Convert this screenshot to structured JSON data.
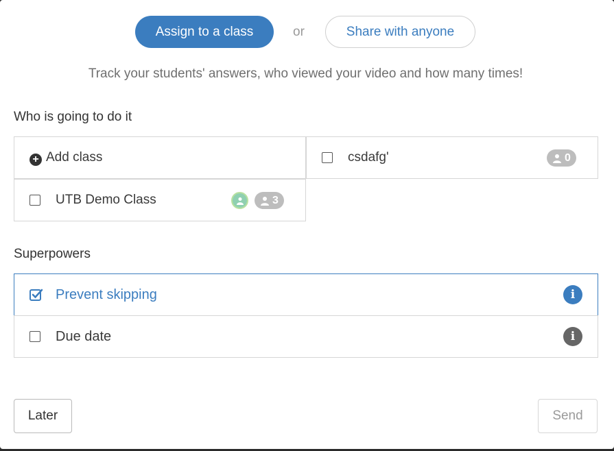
{
  "mode_switch": {
    "assign_label": "Assign to a class",
    "or_label": "or",
    "share_label": "Share with anyone"
  },
  "tagline": "Track your students' answers, who viewed your video and how many times!",
  "who_section": {
    "heading": "Who is going to do it",
    "add_class_label": "Add class",
    "classes": [
      {
        "name": "csdafg'",
        "student_count": "0",
        "checked": false
      },
      {
        "name": "UTB Demo Class",
        "student_count": "3",
        "checked": false,
        "has_avatar": true
      }
    ]
  },
  "superpowers": {
    "heading": "Superpowers",
    "items": [
      {
        "label": "Prevent skipping",
        "checked": true,
        "info_icon": "info-icon"
      },
      {
        "label": "Due date",
        "checked": false,
        "info_icon": "info-icon"
      }
    ]
  },
  "footer": {
    "later_label": "Later",
    "send_label": "Send"
  },
  "colors": {
    "accent": "#3b7dbf",
    "badge_gray": "#bdbdbd",
    "avatar_green": "#8fd0b1",
    "info_active": "#3b7dbf",
    "info_inactive": "#666666"
  }
}
